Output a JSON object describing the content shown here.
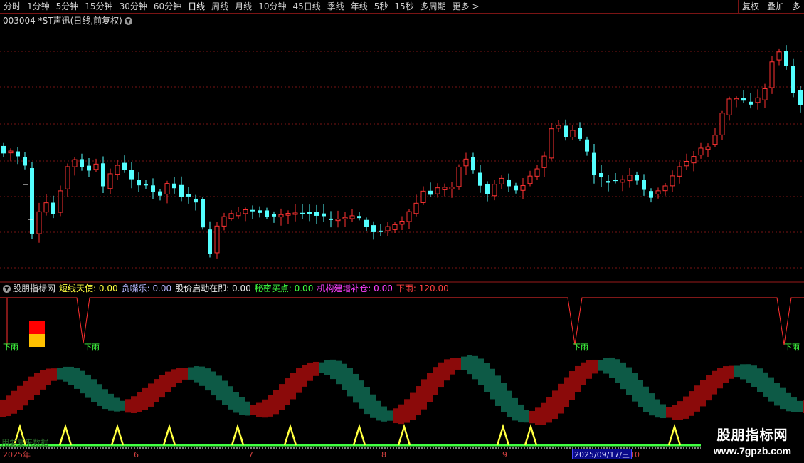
{
  "toolbar": {
    "periods": [
      "分时",
      "1分钟",
      "5分钟",
      "15分钟",
      "30分钟",
      "60分钟",
      "日线",
      "周线",
      "月线",
      "10分钟",
      "45日线",
      "季线",
      "年线",
      "5秒",
      "15秒",
      "多周期",
      "更多 >"
    ],
    "active_period": "日线",
    "right_buttons": [
      "复权",
      "叠加",
      "多"
    ]
  },
  "main_chart": {
    "title": "003004 *ST声迅(日线,前复权)"
  },
  "indicator": {
    "name": "股朋指标网",
    "items": [
      {
        "label": "短线天使: 0.00",
        "color": "#ffff40"
      },
      {
        "label": "贪嘴乐: 0.00",
        "color": "#b8b8ff"
      },
      {
        "label": "股价启动在即: 0.00",
        "color": "#e8e8e8"
      },
      {
        "label": "秘密买点: 0.00",
        "color": "#40ff40"
      },
      {
        "label": "机构建增补仓: 0.00",
        "color": "#ff40ff"
      },
      {
        "label": "下雨: 120.00",
        "color": "#ff4040"
      }
    ],
    "rain_label": "下雨"
  },
  "date_axis": {
    "ticks": [
      "2025年",
      "6",
      "7",
      "8",
      "9",
      "10"
    ],
    "cursor_date": "2025/09/17/三"
  },
  "footer": {
    "left_text": "用要复来数据"
  },
  "logo": {
    "title": "股朋指标网",
    "url": "www.7gpzb.com"
  },
  "colors": {
    "up": "#ff3232",
    "down": "#54ffff",
    "grid": "#7a1414",
    "rain_line": "#ff3030",
    "rain_text": "#40ff40",
    "band_red": "#8b0a0a",
    "band_green": "#0d5a46",
    "triangle": "#ffff40",
    "baseline": "#40ff40"
  }
}
